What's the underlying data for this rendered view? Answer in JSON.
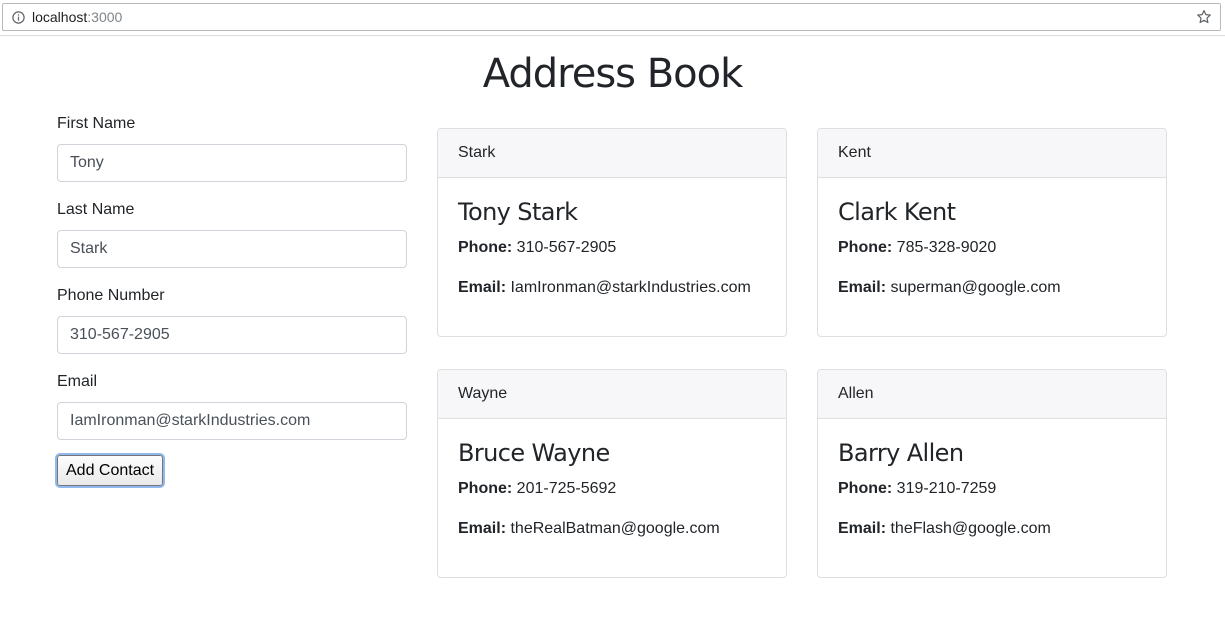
{
  "browser": {
    "url_host": "localhost",
    "url_port": ":3000"
  },
  "page": {
    "title": "Address Book"
  },
  "form": {
    "fields": [
      {
        "label": "First Name",
        "value": "Tony"
      },
      {
        "label": "Last Name",
        "value": "Stark"
      },
      {
        "label": "Phone Number",
        "value": "310-567-2905"
      },
      {
        "label": "Email",
        "value": "IamIronman@starkIndustries.com"
      }
    ],
    "submit_label": "Add Contact"
  },
  "contacts_labels": {
    "phone": "Phone:",
    "email": "Email:"
  },
  "contacts": [
    {
      "header": "Stark",
      "name": "Tony Stark",
      "phone": "310-567-2905",
      "email": "IamIronman@starkIndustries.com"
    },
    {
      "header": "Kent",
      "name": "Clark Kent",
      "phone": "785-328-9020",
      "email": "superman@google.com"
    },
    {
      "header": "Wayne",
      "name": "Bruce Wayne",
      "phone": "201-725-5692",
      "email": "theRealBatman@google.com"
    },
    {
      "header": "Allen",
      "name": "Barry Allen",
      "phone": "319-210-7259",
      "email": "theFlash@google.com"
    }
  ],
  "icons": {
    "info": "info-circle-icon",
    "bookmark": "star-outline-icon"
  }
}
